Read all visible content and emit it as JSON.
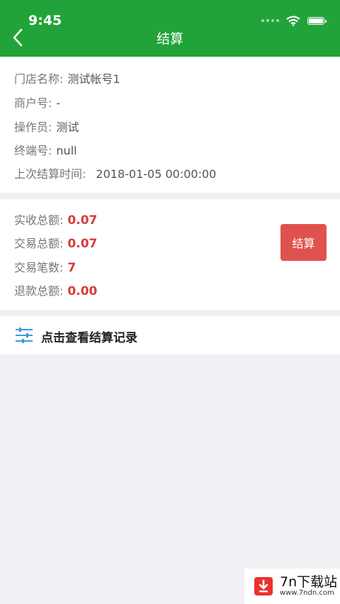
{
  "status_bar": {
    "time": "9:45"
  },
  "nav": {
    "title": "结算",
    "back_icon": "chevron-left-icon"
  },
  "colors": {
    "primary": "#22a33a",
    "accent_red": "#e0524f",
    "value_red": "#d93b3b",
    "background": "#efeff4"
  },
  "store_info": {
    "store_name_label": "门店名称:",
    "store_name_value": "测试帐号1",
    "merchant_no_label": "商户号:",
    "merchant_no_value": "-",
    "operator_label": "操作员:",
    "operator_value": "测试",
    "terminal_no_label": "终端号:",
    "terminal_no_value": "null",
    "last_settle_label": "上次结算时间:",
    "last_settle_value": "2018-01-05 00:00:00"
  },
  "totals": {
    "received_label": "实收总额:",
    "received_value": "0.07",
    "trade_total_label": "交易总额:",
    "trade_total_value": "0.07",
    "trade_count_label": "交易笔数:",
    "trade_count_value": "7",
    "refund_label": "退款总额:",
    "refund_value": "0.00",
    "settle_button": "结算"
  },
  "records": {
    "label": "点击查看结算记录",
    "icon": "sliders-icon"
  },
  "watermark": {
    "name": "7n下载站",
    "url": "www.7ndn.com"
  }
}
